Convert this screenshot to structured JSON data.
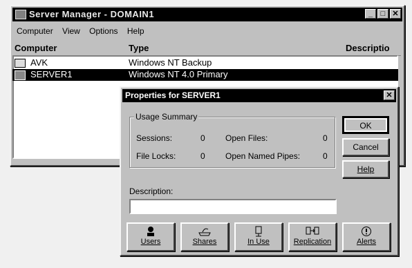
{
  "main_window": {
    "title": "Server Manager - DOMAIN1",
    "menu": [
      "Computer",
      "View",
      "Options",
      "Help"
    ],
    "columns": [
      "Computer",
      "Type",
      "Descriptio"
    ],
    "rows": [
      {
        "computer": "AVK",
        "type": "Windows NT Backup",
        "selected": false
      },
      {
        "computer": "SERVER1",
        "type": "Windows NT 4.0 Primary",
        "selected": true
      }
    ]
  },
  "dialog": {
    "title": "Properties for SERVER1",
    "group_label": "Usage Summary",
    "sessions_label": "Sessions:",
    "sessions_value": "0",
    "file_locks_label": "File Locks:",
    "file_locks_value": "0",
    "open_files_label": "Open Files:",
    "open_files_value": "0",
    "open_pipes_label": "Open Named Pipes:",
    "open_pipes_value": "0",
    "description_label": "Description:",
    "description_value": "",
    "ok_label": "OK",
    "cancel_label": "Cancel",
    "help_label": "Help",
    "bottom_buttons": [
      {
        "label": "Users",
        "icon": "users-icon"
      },
      {
        "label": "Shares",
        "icon": "shares-icon"
      },
      {
        "label": "In Use",
        "icon": "in-use-icon"
      },
      {
        "label": "Replication",
        "icon": "replication-icon"
      },
      {
        "label": "Alerts",
        "icon": "alerts-icon"
      }
    ]
  }
}
